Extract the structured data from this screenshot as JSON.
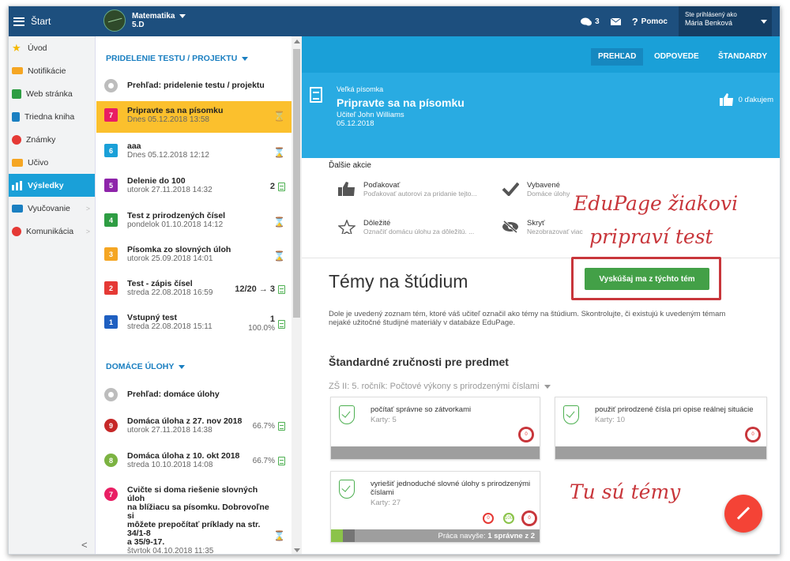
{
  "topbar": {
    "start_label": "Štart",
    "class_name": "Matematika",
    "class_sub": "5.D",
    "messages_count": "3",
    "help_label": "Pomoc",
    "login_label": "Ste prihlásený ako",
    "login_name": "Mária Benková"
  },
  "sidebar": {
    "items": [
      {
        "label": "Úvod",
        "icon": "star-icon",
        "color": "#f5b800"
      },
      {
        "label": "Notifikácie",
        "icon": "mail-icon",
        "color": "#f5a623"
      },
      {
        "label": "Web stránka",
        "icon": "home-icon",
        "color": "#2e9d43"
      },
      {
        "label": "Triedna kniha",
        "icon": "book-icon",
        "color": "#1a7fc1"
      },
      {
        "label": "Známky",
        "icon": "grades-icon",
        "color": "#e53935"
      },
      {
        "label": "Učivo",
        "icon": "learning-icon",
        "color": "#f5a623"
      },
      {
        "label": "Výsledky",
        "icon": "results-icon",
        "color": "#ffffff"
      },
      {
        "label": "Vyučovanie",
        "icon": "teaching-icon",
        "color": "#1a7fc1"
      },
      {
        "label": "Komunikácia",
        "icon": "chat-icon",
        "color": "#e53935"
      }
    ]
  },
  "tests": {
    "header": "PRIDELENIE TESTU / PROJEKTU",
    "overview": "Prehľad: pridelenie testu / projektu",
    "items": [
      {
        "num": "7",
        "color": "#e91e63",
        "title": "Pripravte sa na písomku",
        "date": "Dnes 05.12.2018 13:58",
        "right": ""
      },
      {
        "num": "6",
        "color": "#1aa0d8",
        "title": "aaa",
        "date": "Dnes 05.12.2018 12:12",
        "right": ""
      },
      {
        "num": "5",
        "color": "#8e24aa",
        "title": "Delenie do 100",
        "date": "utorok 27.11.2018 14:32",
        "right": "2"
      },
      {
        "num": "4",
        "color": "#2e9d43",
        "title": "Test z prirodzených čísel",
        "date": "pondelok 01.10.2018 14:12",
        "right": ""
      },
      {
        "num": "3",
        "color": "#f5a623",
        "title": "Písomka zo slovných úloh",
        "date": "utorok 25.09.2018 14:01",
        "right": ""
      },
      {
        "num": "2",
        "color": "#e53935",
        "title": "Test - zápis čísel",
        "date": "streda 22.08.2018 16:59",
        "right": "12/20 → 3"
      },
      {
        "num": "1",
        "color": "#1e5fc1",
        "title": "Vstupný test",
        "date": "streda 22.08.2018 15:11",
        "right": "1",
        "pct": "100.0%"
      }
    ]
  },
  "homework": {
    "header": "DOMÁCE ÚLOHY",
    "overview": "Prehľad: domáce úlohy",
    "items": [
      {
        "num": "9",
        "color": "#c62828",
        "title": "Domáca úloha z 27. nov 2018",
        "date": "utorok 27.11.2018 14:38",
        "pct": "66.7%"
      },
      {
        "num": "8",
        "color": "#43a047",
        "title": "Domáca úloha z 10. okt 2018",
        "date": "streda 10.10.2018 14:08",
        "pct": "66.7%"
      },
      {
        "num": "7",
        "color": "#e91e63",
        "title_lines": [
          "Cvičte si doma riešenie slovných úloh",
          "na blížiacu sa písomku. Dobrovoľne si",
          "môžete prepočítať príklady na str. 34/1-8",
          "a 35/9-17."
        ],
        "date": "štvrtok 04.10.2018 11:35"
      }
    ]
  },
  "main": {
    "tabs": [
      "PREHĽAD",
      "ODPOVEDE",
      "ŠTANDARDY"
    ],
    "hero": {
      "subtitle": "Veľká písomka",
      "title": "Pripravte sa na písomku",
      "teacher": "Učiteľ John Williams",
      "date": "05.12.2018",
      "thanks": "0 ďakujem"
    },
    "further_title": "Ďalšie akcie",
    "actions": [
      {
        "title": "Poďakovať",
        "sub": "Poďakovať autorovi za pridanie tejto...",
        "icon": "thumbs-up-icon"
      },
      {
        "title": "Vybavené",
        "sub": "Domáce úlohy",
        "icon": "check-icon"
      },
      {
        "title": "Dôležité",
        "sub": "Označiť domácu úlohu za dôležitú. ...",
        "icon": "star-outline-icon"
      },
      {
        "title": "Skryť",
        "sub": "Nezobrazovať viac",
        "icon": "eye-slash-icon"
      }
    ],
    "topics_title": "Témy na štúdium",
    "try_button": "Vyskúšaj ma z týchto tém",
    "description": "Dole je uvedený zoznam tém, ktoré váš učiteľ označil ako témy na štúdium. Skontrolujte, či existujú k uvedeným témam nejaké užitočné študijné materiály v databáze EduPage.",
    "standards_title": "Štandardné zručnosti pre predmet",
    "standards_sub": "ZŠ II: 5. ročník: Počtové výkony s prirodzenými číslami",
    "cards": [
      {
        "title": "počítať správne so zátvorkami",
        "cards_label": "Karty: 5"
      },
      {
        "title": "použiť prirodzené čísla pri opise reálnej situácie",
        "cards_label": "Karty: 10"
      },
      {
        "title_lines": [
          "vyriešiť jednoduché slovné úlohy s prirodzenými",
          "číslami"
        ],
        "cards_label": "Karty: 27",
        "footer": "Práca navyše:",
        "footer_bold": "1 správne z 2"
      }
    ],
    "zero": "0",
    "hundred": "100"
  },
  "annotations": {
    "line1": "EduPage žiakovi",
    "line2": "pripraví test",
    "line3": "Tu sú témy"
  }
}
